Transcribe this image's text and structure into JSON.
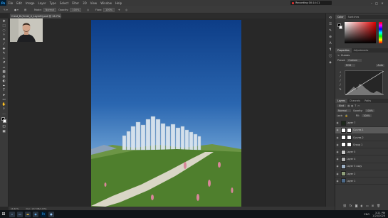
{
  "menubar": {
    "logo": "Ps",
    "items": [
      "File",
      "Edit",
      "Image",
      "Layer",
      "Type",
      "Select",
      "Filter",
      "3D",
      "View",
      "Window",
      "Help"
    ],
    "recording": "Recording 00:14:11"
  },
  "options": {
    "mode_label": "Mode:",
    "mode_value": "Normal",
    "opacity_label": "Opacity:",
    "opacity_value": "100%",
    "flow_label": "Flow:",
    "flow_value": "100%"
  },
  "document": {
    "tab_title": "Crest_8-(Crest_4_Layer8).psd @ 16.7% (Layer 1, RGB/8#) ×"
  },
  "status": {
    "zoom": "16.67%",
    "doc_size": "Doc: 137.3M/1.87G"
  },
  "panels": {
    "color_tabs": [
      "Color",
      "Swatches"
    ],
    "properties_tabs": [
      "Properties",
      "Adjustments"
    ],
    "properties_title": "Curves",
    "preset_label": "Preset:",
    "preset_value": "Custom",
    "channel_value": "RGB",
    "auto_label": "Auto",
    "layers_tabs": [
      "Layers",
      "Channels",
      "Paths"
    ],
    "kind_label": "Kind",
    "blend_value": "Normal",
    "opacity_label": "Opacity:",
    "opacity_value": "100%",
    "lock_label": "Lock:",
    "fill_label": "Fill:",
    "fill_value": "100%"
  },
  "layers": [
    {
      "name": "Layer 7",
      "mask": false
    },
    {
      "name": "Curves 1",
      "mask": true,
      "selected": true
    },
    {
      "name": "Curves 2",
      "mask": true
    },
    {
      "name": "Group 1",
      "mask": true
    },
    {
      "name": "Layer 5",
      "mask": false
    },
    {
      "name": "Layer 4",
      "mask": false
    },
    {
      "name": "Layer 3 copy",
      "mask": false
    },
    {
      "name": "Layer 2",
      "mask": false
    },
    {
      "name": "Layer 1",
      "mask": false
    }
  ],
  "taskbar": {
    "time": "3:21 PM",
    "date": "1/24/2020",
    "lang": "ENG"
  },
  "colors": {
    "accent": "#31a8ff",
    "foreground": "#000000",
    "background": "#ffffff"
  }
}
